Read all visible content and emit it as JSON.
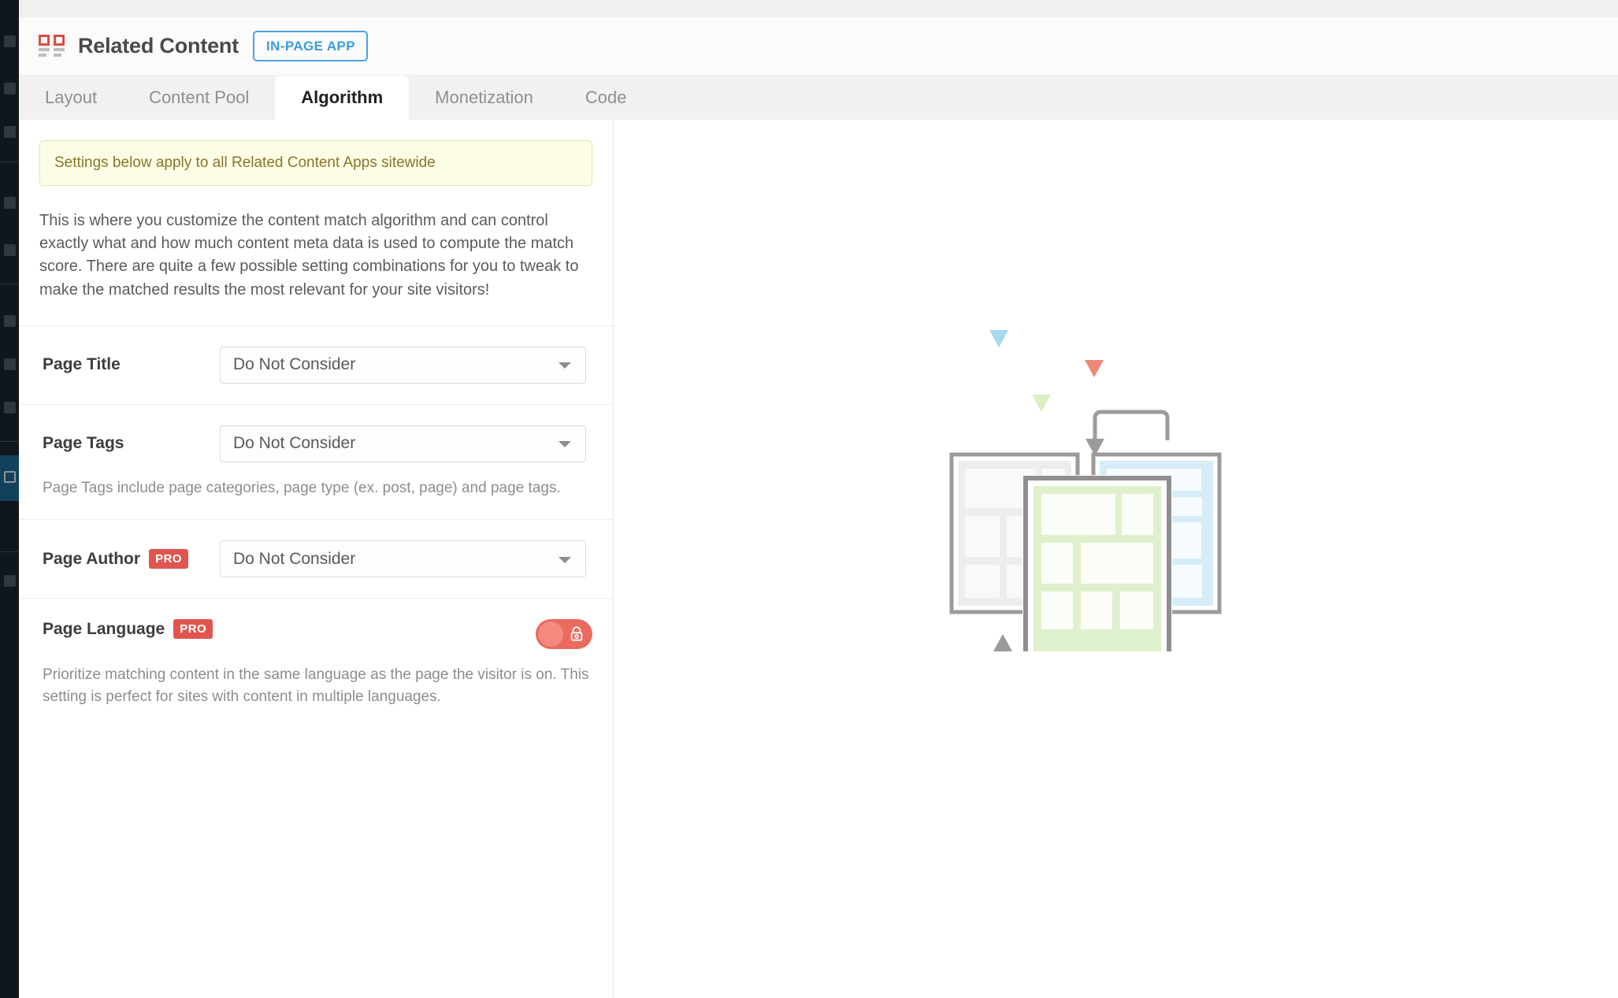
{
  "header": {
    "icon": "related-content-app-icon",
    "title": "Related Content",
    "badge": "IN-PAGE APP"
  },
  "tabs": [
    {
      "label": "Layout",
      "active": false
    },
    {
      "label": "Content Pool",
      "active": false
    },
    {
      "label": "Algorithm",
      "active": true
    },
    {
      "label": "Monetization",
      "active": false
    },
    {
      "label": "Code",
      "active": false
    }
  ],
  "notice": {
    "text": "Settings below apply to all Related Content Apps sitewide"
  },
  "intro": {
    "text": "This is where you customize the content match algorithm and can control exactly what and how much content meta data is used to compute the match score. There are quite a few possible setting combinations for you to tweak to make the matched results the most relevant for your site visitors!"
  },
  "settings": [
    {
      "label": "Page Title",
      "pro": "",
      "control": "select",
      "value": "Do Not Consider",
      "help": ""
    },
    {
      "label": "Page Tags",
      "pro": "",
      "control": "select",
      "value": "Do Not Consider",
      "help": "Page Tags include page categories, page type (ex. post, page) and page tags."
    },
    {
      "label": "Page Author",
      "pro": "PRO",
      "control": "select",
      "value": "Do Not Consider",
      "help": ""
    },
    {
      "label": "Page Language",
      "pro": "PRO",
      "control": "toggle",
      "value": "off-locked",
      "help": "Prioritize matching content in the same language as the page the visitor is on. This setting is perfect for sites with content in multiple languages."
    }
  ],
  "illustration": {
    "name": "related-content-pages-diagram",
    "colors": {
      "blue_marker": "#a8d8f0",
      "red_marker": "#f08878",
      "green_marker": "#d6ecc0",
      "frame_gray": "#9b9b9b",
      "page_blue": "#d6ecf8",
      "page_green": "#dff0cd"
    }
  },
  "colors": {
    "accent_red": "#df4b43",
    "badge_blue": "#3d9ae0",
    "notice_bg": "#fdfde7",
    "notice_border": "#e4e4ae",
    "notice_text": "#8a7627",
    "pro_badge": "#e0564f",
    "toggle_on": "#ea6a5e",
    "tab_bar": "#f1f1f1",
    "wp_sidebar": "#10171c",
    "wp_sidebar_active": "#13405c"
  }
}
